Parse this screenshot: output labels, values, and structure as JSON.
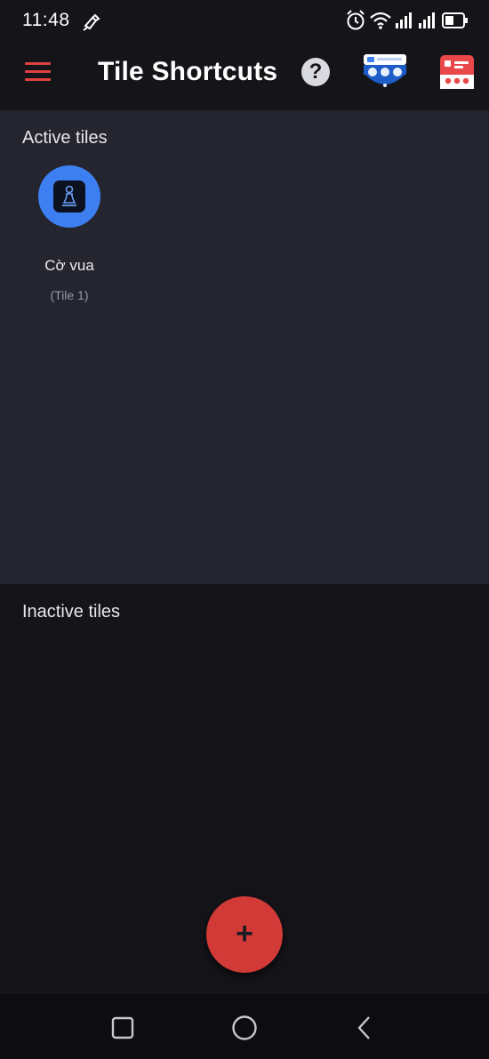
{
  "status_bar": {
    "time": "11:48",
    "icons": [
      "brush-icon",
      "alarm-icon",
      "wifi-icon",
      "signal-icon",
      "signal-icon",
      "battery-icon"
    ]
  },
  "app_bar": {
    "title": "Tile Shortcuts",
    "menu_icon": "hamburger-menu-icon",
    "help_label": "?",
    "actions": [
      "quick-settings-icon",
      "tile-list-icon"
    ]
  },
  "colors": {
    "accent": "#e0413f",
    "fab": "#d13a37",
    "tile": "#3d7ff0",
    "active_bg": "#25252f",
    "background": "#141419"
  },
  "active_section": {
    "title": "Active tiles",
    "tiles": [
      {
        "name": "Cờ vua",
        "subtitle": "(Tile 1)",
        "icon": "chess-pawn-icon"
      }
    ]
  },
  "inactive_section": {
    "title": "Inactive tiles"
  },
  "fab": {
    "label": "+"
  },
  "nav_bar": {
    "buttons": [
      "recents-icon",
      "home-icon",
      "back-icon"
    ]
  }
}
